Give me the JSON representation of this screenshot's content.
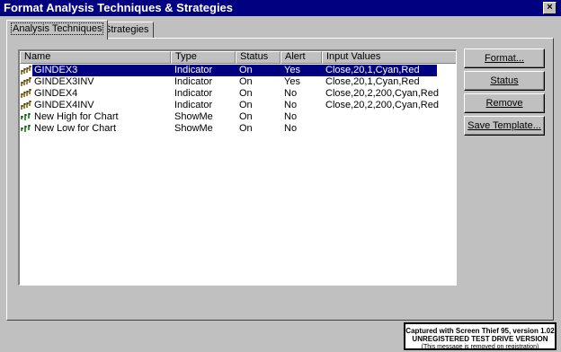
{
  "window": {
    "title": "Format Analysis Techniques & Strategies",
    "close_glyph": "×"
  },
  "tabs": [
    {
      "label": "Analysis Techniques",
      "active": true
    },
    {
      "label": "Strategies",
      "active": false
    }
  ],
  "list": {
    "columns": [
      "Name",
      "Type",
      "Status",
      "Alert",
      "Input Values"
    ],
    "rows": [
      {
        "icon": "indicator-icon",
        "name": "GINDEX3",
        "type": "Indicator",
        "status": "On",
        "alert": "Yes",
        "inputs": "Close,20,1,Cyan,Red",
        "selected": true
      },
      {
        "icon": "indicator-icon",
        "name": "GINDEX3INV",
        "type": "Indicator",
        "status": "On",
        "alert": "Yes",
        "inputs": "Close,20,1,Cyan,Red",
        "selected": false
      },
      {
        "icon": "indicator-icon",
        "name": "GINDEX4",
        "type": "Indicator",
        "status": "On",
        "alert": "No",
        "inputs": "Close,20,2,200,Cyan,Red",
        "selected": false
      },
      {
        "icon": "indicator-icon",
        "name": "GINDEX4INV",
        "type": "Indicator",
        "status": "On",
        "alert": "No",
        "inputs": "Close,20,2,200,Cyan,Red",
        "selected": false
      },
      {
        "icon": "showme-icon",
        "name": "New High for Chart",
        "type": "ShowMe",
        "status": "On",
        "alert": "No",
        "inputs": "",
        "selected": false
      },
      {
        "icon": "showme-icon",
        "name": "New Low for Chart",
        "type": "ShowMe",
        "status": "On",
        "alert": "No",
        "inputs": "",
        "selected": false
      }
    ]
  },
  "buttons": {
    "format": "Format...",
    "status": "Status",
    "remove": "Remove",
    "save_template": "Save Template..."
  },
  "watermark": {
    "line1": "Captured with Screen Thief 95, version 1.02",
    "line2": "UNREGISTERED TEST DRIVE VERSION",
    "line3": "(This message is removed on registration)"
  },
  "colors": {
    "titlebar": "#000080",
    "selection": "#000080",
    "indicator_bar": "#806000",
    "showme_bar": "#008000"
  }
}
